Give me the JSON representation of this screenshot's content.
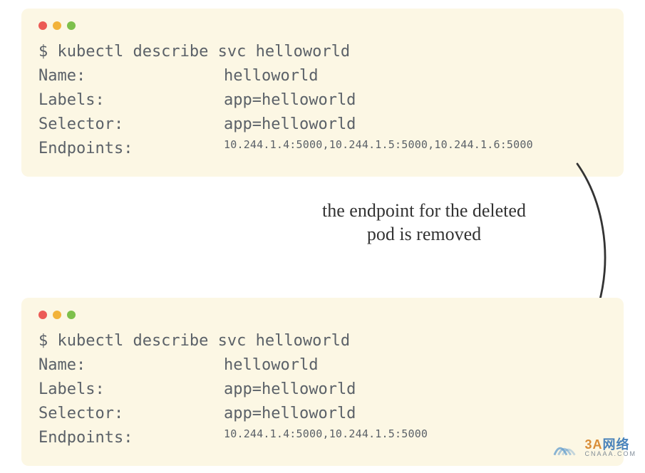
{
  "top": {
    "command": "$ kubectl describe svc helloworld",
    "rows": [
      {
        "k": "Name:",
        "v": "helloworld"
      },
      {
        "k": "Labels:",
        "v": "app=helloworld"
      },
      {
        "k": "Selector:",
        "v": "app=helloworld"
      }
    ],
    "endpoints_k": "Endpoints:",
    "endpoints_v": "10.244.1.4:5000,10.244.1.5:5000,10.244.1.6:5000"
  },
  "bottom": {
    "command": "$ kubectl describe svc helloworld",
    "rows": [
      {
        "k": "Name:",
        "v": "helloworld"
      },
      {
        "k": "Labels:",
        "v": "app=helloworld"
      },
      {
        "k": "Selector:",
        "v": "app=helloworld"
      }
    ],
    "endpoints_k": "Endpoints:",
    "endpoints_v": "10.244.1.4:5000,10.244.1.5:5000"
  },
  "annotation": {
    "line1": "the endpoint for the deleted",
    "line2": "pod is removed"
  },
  "watermark": {
    "brand_main": "3A",
    "brand_rest": "网络",
    "sub": "CNAAA.COM"
  }
}
